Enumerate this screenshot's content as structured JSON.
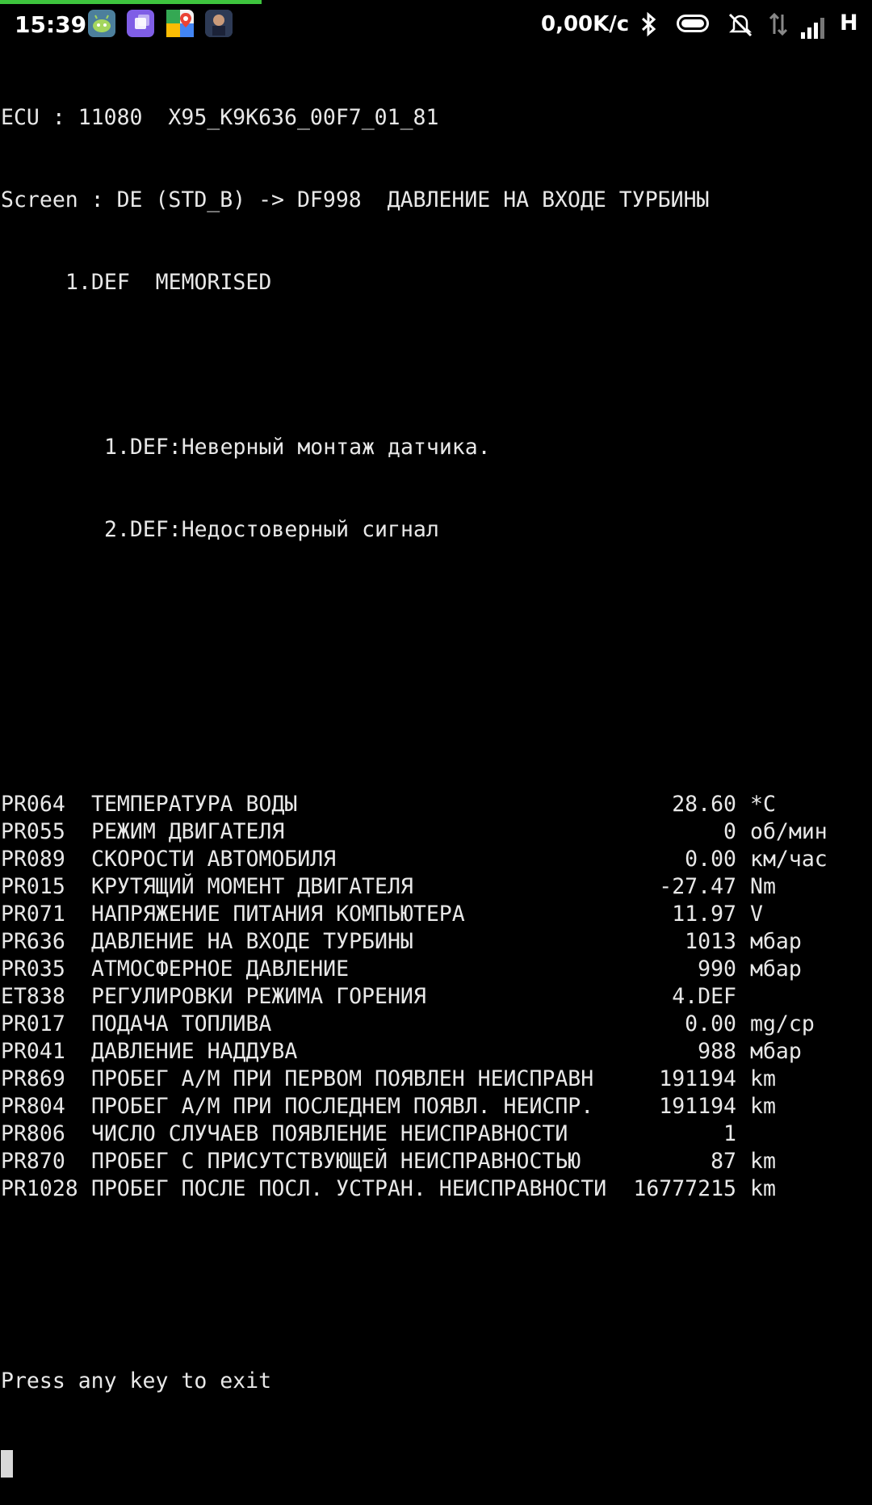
{
  "status_bar": {
    "time": "15:39",
    "net_speed": "0,00K/c",
    "network_type": "H",
    "apps": [
      "android-robot-app-icon",
      "purple-app-icon",
      "google-maps-app-icon",
      "game-app-icon"
    ],
    "accent": "#3ec43e",
    "progress": 0.3
  },
  "terminal": {
    "header": {
      "ecu": "ECU : 11080  X95_K9K636_00F7_01_81",
      "screen": "Screen : DE (STD_B) -> DF998  ДАВЛЕНИЕ НА ВХОДЕ ТУРБИНЫ",
      "status": "1.DEF  MEMORISED"
    },
    "faults": [
      "1.DEF:Неверный монтаж датчика.",
      "2.DEF:Недостоверный сигнал"
    ],
    "params": [
      {
        "code": "PR064",
        "name": "ТЕМПЕРАТУРА ВОДЫ",
        "value": "28.60",
        "unit": "*C"
      },
      {
        "code": "PR055",
        "name": "РЕЖИМ ДВИГАТЕЛЯ",
        "value": "0",
        "unit": "об/мин"
      },
      {
        "code": "PR089",
        "name": "СКОРОСТИ АВТОМОБИЛЯ",
        "value": "0.00",
        "unit": "км/час"
      },
      {
        "code": "PR015",
        "name": "КРУТЯЩИЙ МОМЕНТ ДВИГАТЕЛЯ",
        "value": "-27.47",
        "unit": "Nm"
      },
      {
        "code": "PR071",
        "name": "НАПРЯЖЕНИЕ ПИТАНИЯ КОМПЬЮТЕРА",
        "value": "11.97",
        "unit": "V"
      },
      {
        "code": "PR636",
        "name": "ДАВЛЕНИЕ НА ВХОДЕ ТУРБИНЫ",
        "value": "1013",
        "unit": "мбар"
      },
      {
        "code": "PR035",
        "name": "АТМОСФЕРНОЕ ДАВЛЕНИЕ",
        "value": "990",
        "unit": "мбар"
      },
      {
        "code": "ET838",
        "name": "РЕГУЛИРОВКИ РЕЖИМА ГОРЕНИЯ",
        "value": "4.DEF",
        "unit": ""
      },
      {
        "code": "PR017",
        "name": "ПОДАЧА ТОПЛИВА",
        "value": "0.00",
        "unit": "mg/cp"
      },
      {
        "code": "PR041",
        "name": "ДАВЛЕНИЕ НАДДУВА",
        "value": "988",
        "unit": "мбар"
      },
      {
        "code": "PR869",
        "name": "ПРОБЕГ А/М ПРИ ПЕРВОМ ПОЯВЛЕН НЕИСПРАВН",
        "value": "191194",
        "unit": "km"
      },
      {
        "code": "PR804",
        "name": "ПРОБЕГ А/М ПРИ ПОСЛЕДНЕМ ПОЯВЛ. НЕИСПР.",
        "value": "191194",
        "unit": "km"
      },
      {
        "code": "PR806",
        "name": "ЧИСЛО СЛУЧАЕВ ПОЯВЛЕНИЕ НЕИСПРАВНОСТИ",
        "value": "1",
        "unit": ""
      },
      {
        "code": "PR870",
        "name": "ПРОБЕГ С ПРИСУТСТВУЮЩЕЙ НЕИСПРАВНОСТЬЮ",
        "value": "87",
        "unit": "km"
      },
      {
        "code": "PR1028",
        "name": "ПРОБЕГ ПОСЛЕ ПОСЛ. УСТРАН. НЕИСПРАВНОСТИ",
        "value": "16777215",
        "unit": "km"
      }
    ],
    "footer": "Press any key to exit"
  }
}
